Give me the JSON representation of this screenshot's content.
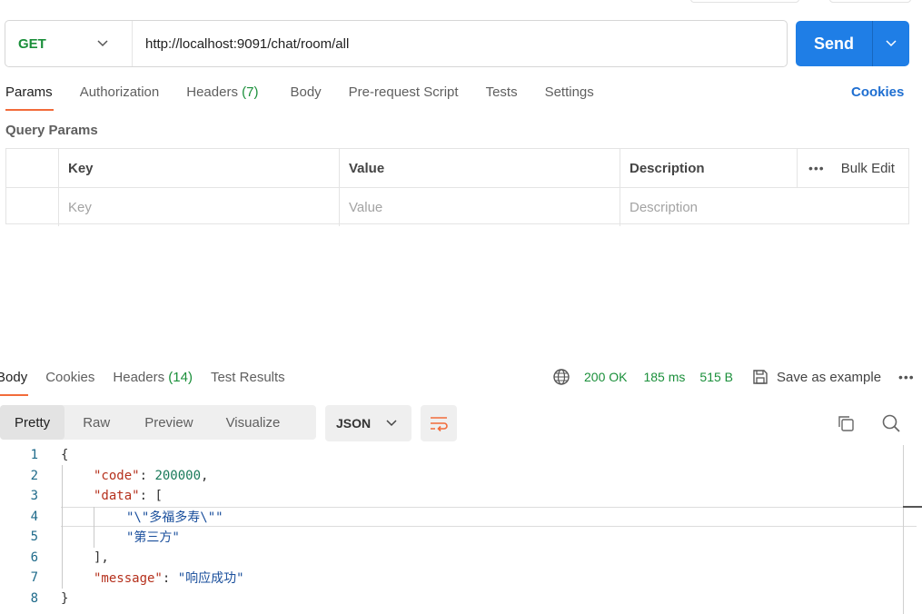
{
  "request": {
    "method": "GET",
    "url": "http://localhost:9091/chat/room/all",
    "send_label": "Send"
  },
  "tabs": [
    {
      "label": "Params",
      "active": true
    },
    {
      "label": "Authorization"
    },
    {
      "label": "Headers",
      "count": "(7)"
    },
    {
      "label": "Body"
    },
    {
      "label": "Pre-request Script"
    },
    {
      "label": "Tests"
    },
    {
      "label": "Settings"
    }
  ],
  "cookies_label": "Cookies",
  "query_params": {
    "title": "Query Params",
    "headers": {
      "key": "Key",
      "value": "Value",
      "description": "Description"
    },
    "bulk_edit": "Bulk Edit",
    "placeholders": {
      "key": "Key",
      "value": "Value",
      "description": "Description"
    }
  },
  "response": {
    "tabs": [
      {
        "label": "Body",
        "active": true
      },
      {
        "label": "Cookies"
      },
      {
        "label": "Headers",
        "count": "(14)"
      },
      {
        "label": "Test Results"
      }
    ],
    "status": "200 OK",
    "time": "185 ms",
    "size": "515 B",
    "save_label": "Save as example",
    "formats": [
      "Pretty",
      "Raw",
      "Preview",
      "Visualize"
    ],
    "active_format": "Pretty",
    "language": "JSON"
  },
  "code": {
    "line_numbers": [
      "1",
      "2",
      "3",
      "4",
      "5",
      "6",
      "7",
      "8"
    ],
    "open_brace": "{",
    "close_brace": "}",
    "code_key": "\"code\"",
    "code_value": "200000",
    "data_key": "\"data\"",
    "data_open": "[",
    "data_close": "],",
    "item1": "\"\\\"多福多寿\\\"\"",
    "item2": "\"第三方\"",
    "message_key": "\"message\"",
    "message_value": "\"响应成功\""
  },
  "colors": {
    "accent": "#1f7ee6",
    "tab_underline": "#f26b3a",
    "status_ok": "#1a8f3a"
  }
}
